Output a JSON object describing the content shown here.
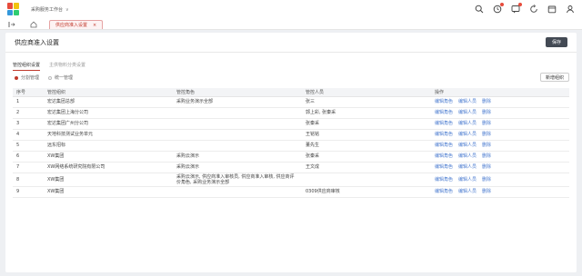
{
  "brand_colors": {
    "accent": "#c0392b",
    "link": "#4a7bd0",
    "dark_button": "#434a54"
  },
  "app": {
    "title": "采购服务工作台",
    "chevron": "∨"
  },
  "top_icons": [
    "search-icon",
    "clock-icon",
    "message-icon",
    "refresh-icon",
    "calendar-icon",
    "user-icon"
  ],
  "tab": {
    "label": "供应商准入设置",
    "close": "×"
  },
  "page": {
    "title": "供应商准入设置",
    "save_label": "保存"
  },
  "subtabs": [
    "管控组织设置",
    "主供物料分类设置"
  ],
  "radios": [
    "分割管理",
    "统一管理"
  ],
  "add_org_label": "新增组织",
  "table": {
    "headers": [
      "序号",
      "管控组织",
      "管控角色",
      "管控人员",
      "操作"
    ],
    "rows": [
      {
        "no": "1",
        "org": "宏达集团总部",
        "role": "采购业务演示全部",
        "person": "张三"
      },
      {
        "no": "2",
        "org": "宏达集团上海分公司",
        "role": "",
        "person": "郭上彩, 张秦采"
      },
      {
        "no": "3",
        "org": "宏达集团广州分公司",
        "role": "",
        "person": "张秦采"
      },
      {
        "no": "4",
        "org": "天地科技测试业务单元",
        "role": "",
        "person": "王铭铭"
      },
      {
        "no": "5",
        "org": "远东招标",
        "role": "",
        "person": "董先生"
      },
      {
        "no": "6",
        "org": "XW集团",
        "role": "采购云演示",
        "person": "张秦采"
      },
      {
        "no": "7",
        "org": "XW网络系统研究院有限公司",
        "role": "采购云演示",
        "person": "王文成"
      },
      {
        "no": "8",
        "org": "XW集团",
        "role": "采购云演示, 供应商准入审核员, 供应商准入审核, 供应商评价角色, 采购业务演示全部",
        "person": ""
      },
      {
        "no": "9",
        "org": "XW集团",
        "role": "",
        "person": "0309供应商审核"
      }
    ],
    "ops": [
      "编辑角色",
      "编辑人员",
      "删除"
    ]
  }
}
